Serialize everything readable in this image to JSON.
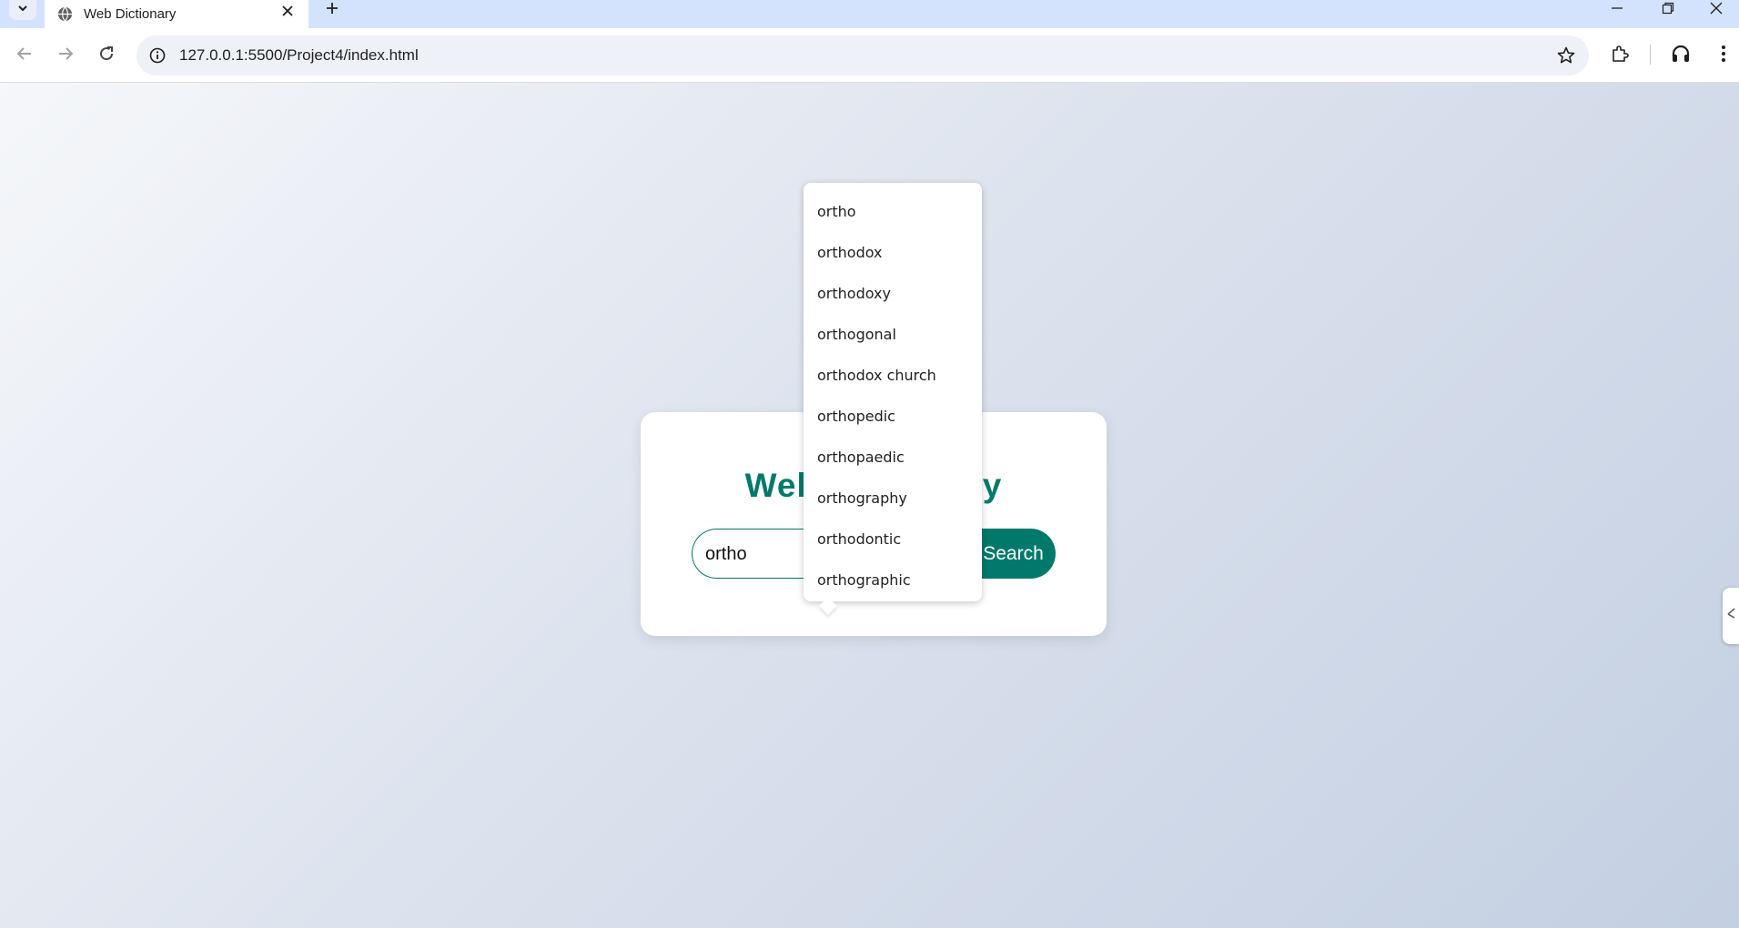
{
  "browser": {
    "tab_title": "Web Dictionary",
    "url": "127.0.0.1:5500/Project4/index.html",
    "icons": {
      "tab_list": "chevron-down-icon",
      "favicon": "globe-icon",
      "tab_close": "close-icon",
      "new_tab": "plus-icon",
      "minimize": "minimize-icon",
      "restore": "restore-icon",
      "close_window": "close-icon",
      "back": "arrow-left-icon",
      "forward": "arrow-right-icon",
      "reload": "reload-icon",
      "site_info": "info-icon",
      "bookmark": "star-icon",
      "extensions": "puzzle-icon",
      "headphones": "headphones-icon",
      "menu": "kebab-menu-icon"
    }
  },
  "page": {
    "title": "Web Dictionary",
    "search": {
      "value": "ortho",
      "button_label": "Search"
    },
    "suggestions": [
      "ortho",
      "orthodox",
      "orthodoxy",
      "orthogonal",
      "orthodox church",
      "orthopedic",
      "orthopaedic",
      "orthography",
      "orthodontic",
      "orthographic"
    ]
  },
  "colors": {
    "accent": "#00796b",
    "tabbar": "#d3e3fd",
    "omnibox": "#eef1f7"
  }
}
